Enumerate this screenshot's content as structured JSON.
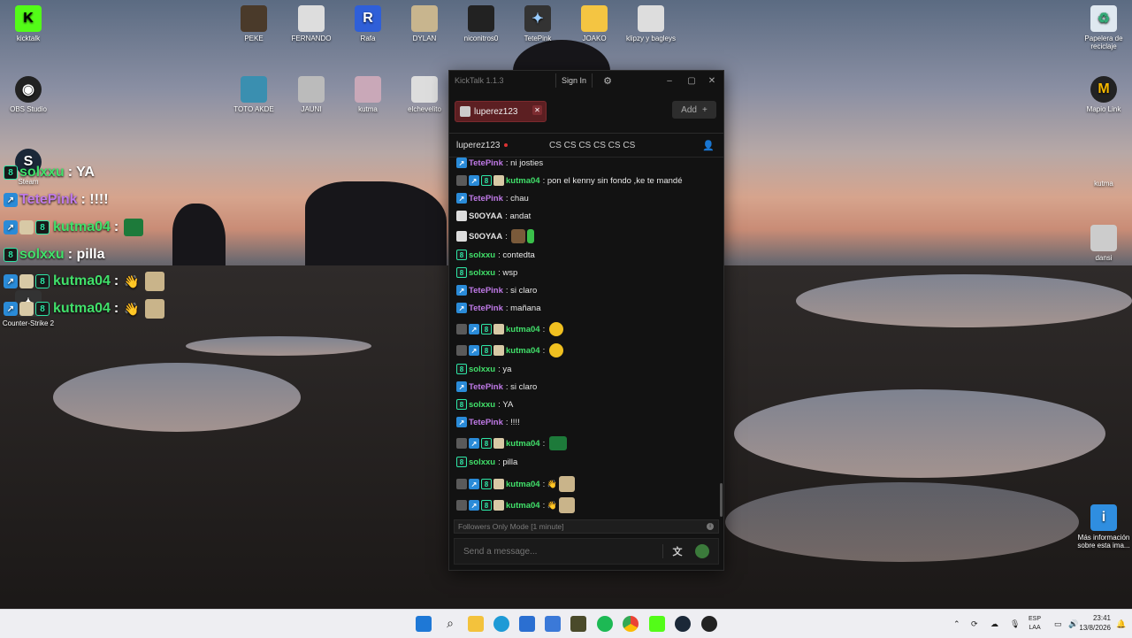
{
  "desktop": {
    "icons_top": [
      "kicktalk",
      "PEKE",
      "FERNANDO",
      "Rafa",
      "DYLAN",
      "niconitros0",
      "TetePink",
      "JOAKO",
      "klipzy y bagleys"
    ],
    "icons_row2": [
      "OBS Studio",
      "TOTO AKDE",
      "JAUNI",
      "kutma",
      "elchevelito"
    ],
    "icons_left": [
      "Steam",
      "Counter-Strike 2"
    ],
    "icons_right": [
      "Papelera de reciclaje",
      "Mapio Link",
      "kutma",
      "dansi",
      "Más información sobre esta ima..."
    ]
  },
  "overlay": [
    {
      "user": "solxxu",
      "text": ": YA",
      "color": "#41e06a"
    },
    {
      "user": "TetePink",
      "text": ": !!!!",
      "color": "#c07ae8"
    },
    {
      "user": "kutma04",
      "text": ":",
      "color": "#41e06a"
    },
    {
      "user": "solxxu",
      "text": ": pilla",
      "color": "#41e06a"
    },
    {
      "user": "kutma04",
      "text": ":",
      "color": "#41e06a"
    },
    {
      "user": "kutma04",
      "text": ":",
      "color": "#41e06a"
    }
  ],
  "window": {
    "title": "KickTalk 1.1.3",
    "sign_in": "Sign In",
    "tab_name": "luperez123",
    "add_label": "Add",
    "channel_name": "luperez123",
    "stream_title": "CS CS CS CS CS CS",
    "followers_mode": "Followers Only Mode [1 minute]",
    "input_placeholder": "Send a message..."
  },
  "messages": [
    {
      "user": "TetePink",
      "text": "ni josties",
      "color": "#c07ae8"
    },
    {
      "user": "kutma04",
      "text": "pon el kenny sin fondo ,ke te mandé",
      "color": "#41e06a"
    },
    {
      "user": "TetePink",
      "text": "chau",
      "color": "#c07ae8"
    },
    {
      "user": "S0OYAA",
      "text": "andat",
      "color": "#e0e0e0"
    },
    {
      "user": "S0OYAA",
      "text": "",
      "color": "#e0e0e0"
    },
    {
      "user": "solxxu",
      "text": "contedta",
      "color": "#41e06a"
    },
    {
      "user": "solxxu",
      "text": "wsp",
      "color": "#41e06a"
    },
    {
      "user": "TetePink",
      "text": "si claro",
      "color": "#c07ae8"
    },
    {
      "user": "TetePink",
      "text": "mañana",
      "color": "#c07ae8"
    },
    {
      "user": "kutma04",
      "text": "",
      "color": "#41e06a"
    },
    {
      "user": "kutma04",
      "text": "",
      "color": "#41e06a"
    },
    {
      "user": "solxxu",
      "text": "ya",
      "color": "#41e06a"
    },
    {
      "user": "TetePink",
      "text": "si claro",
      "color": "#c07ae8"
    },
    {
      "user": "solxxu",
      "text": "YA",
      "color": "#41e06a"
    },
    {
      "user": "TetePink",
      "text": "!!!!",
      "color": "#c07ae8"
    },
    {
      "user": "kutma04",
      "text": "",
      "color": "#41e06a"
    },
    {
      "user": "solxxu",
      "text": "pilla",
      "color": "#41e06a"
    },
    {
      "user": "kutma04",
      "text": "",
      "color": "#41e06a"
    },
    {
      "user": "kutma04",
      "text": "",
      "color": "#41e06a"
    }
  ],
  "taskbar": {
    "lang_top": "ESP",
    "lang_bottom": "LAA",
    "time": "23:41",
    "date": "13/8/2026"
  }
}
